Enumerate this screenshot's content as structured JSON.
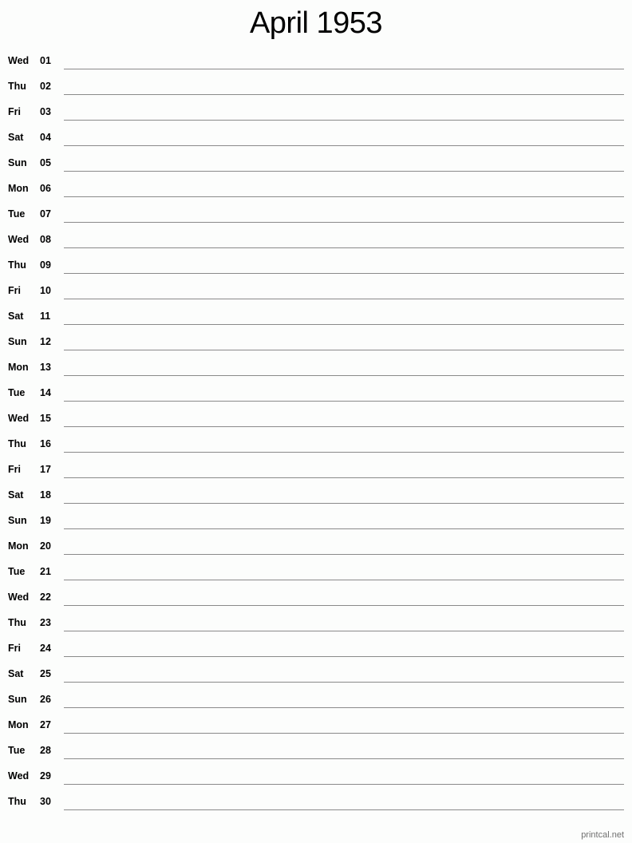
{
  "title": "April 1953",
  "days": [
    {
      "dow": "Wed",
      "day": "01"
    },
    {
      "dow": "Thu",
      "day": "02"
    },
    {
      "dow": "Fri",
      "day": "03"
    },
    {
      "dow": "Sat",
      "day": "04"
    },
    {
      "dow": "Sun",
      "day": "05"
    },
    {
      "dow": "Mon",
      "day": "06"
    },
    {
      "dow": "Tue",
      "day": "07"
    },
    {
      "dow": "Wed",
      "day": "08"
    },
    {
      "dow": "Thu",
      "day": "09"
    },
    {
      "dow": "Fri",
      "day": "10"
    },
    {
      "dow": "Sat",
      "day": "11"
    },
    {
      "dow": "Sun",
      "day": "12"
    },
    {
      "dow": "Mon",
      "day": "13"
    },
    {
      "dow": "Tue",
      "day": "14"
    },
    {
      "dow": "Wed",
      "day": "15"
    },
    {
      "dow": "Thu",
      "day": "16"
    },
    {
      "dow": "Fri",
      "day": "17"
    },
    {
      "dow": "Sat",
      "day": "18"
    },
    {
      "dow": "Sun",
      "day": "19"
    },
    {
      "dow": "Mon",
      "day": "20"
    },
    {
      "dow": "Tue",
      "day": "21"
    },
    {
      "dow": "Wed",
      "day": "22"
    },
    {
      "dow": "Thu",
      "day": "23"
    },
    {
      "dow": "Fri",
      "day": "24"
    },
    {
      "dow": "Sat",
      "day": "25"
    },
    {
      "dow": "Sun",
      "day": "26"
    },
    {
      "dow": "Mon",
      "day": "27"
    },
    {
      "dow": "Tue",
      "day": "28"
    },
    {
      "dow": "Wed",
      "day": "29"
    },
    {
      "dow": "Thu",
      "day": "30"
    }
  ],
  "footer": "printcal.net"
}
